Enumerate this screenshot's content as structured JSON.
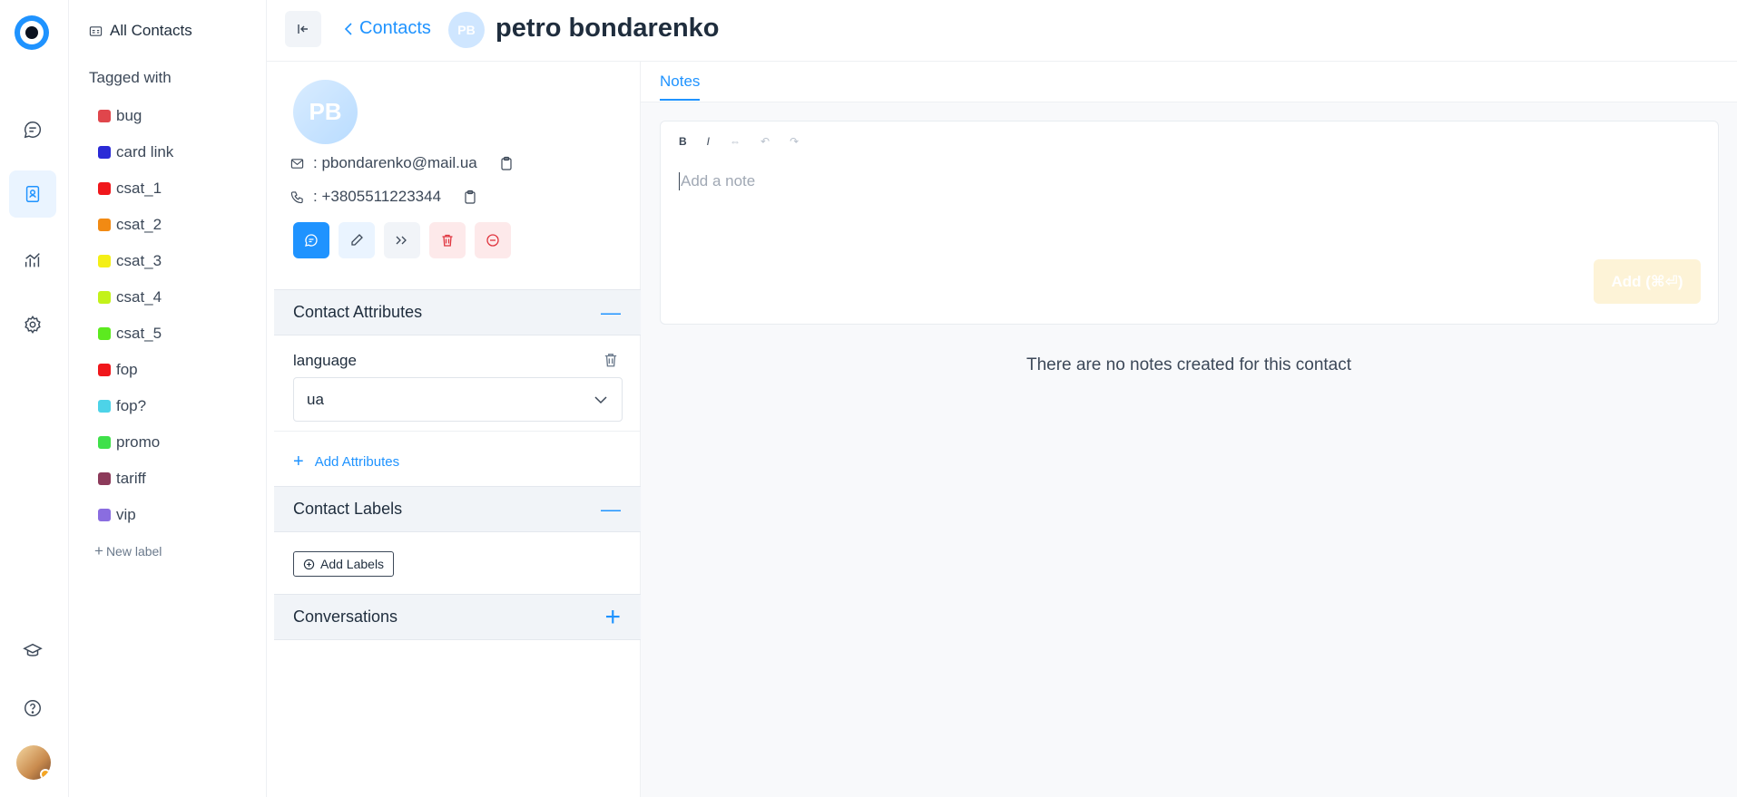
{
  "sidebar": {
    "all_contacts": "All Contacts",
    "tagged_with": "Tagged with",
    "labels": [
      {
        "name": "bug",
        "color": "#e0464c"
      },
      {
        "name": "card link",
        "color": "#2a2ad6"
      },
      {
        "name": "csat_1",
        "color": "#f0171b"
      },
      {
        "name": "csat_2",
        "color": "#f28a13"
      },
      {
        "name": "csat_3",
        "color": "#f4ef16"
      },
      {
        "name": "csat_4",
        "color": "#c3f21a"
      },
      {
        "name": "csat_5",
        "color": "#5cea1f"
      },
      {
        "name": "fop",
        "color": "#f0171b"
      },
      {
        "name": "fop?",
        "color": "#4dd3e8"
      },
      {
        "name": "promo",
        "color": "#3fe04a"
      },
      {
        "name": "tariff",
        "color": "#8c3a5a"
      },
      {
        "name": "vip",
        "color": "#8a6de0"
      }
    ],
    "new_label": "New label"
  },
  "header": {
    "breadcrumb": "Contacts",
    "avatar_initials": "PB",
    "contact_name": "petro bondarenko"
  },
  "contact": {
    "initials": "PB",
    "email": ": pbondarenko@mail.ua",
    "phone": ": +3805511223344"
  },
  "attributes": {
    "title": "Contact Attributes",
    "items": [
      {
        "name": "language",
        "value": "ua"
      }
    ],
    "add_label": "Add Attributes"
  },
  "labels_section": {
    "title": "Contact Labels",
    "add_label": "Add Labels"
  },
  "conversations": {
    "title": "Conversations"
  },
  "notes": {
    "tab": "Notes",
    "toolbar": {
      "bold": "B",
      "italic": "I"
    },
    "placeholder": "Add a note",
    "add_button": "Add (⌘⏎)",
    "empty_text": "There are no notes created for this contact"
  },
  "colors": {
    "accent": "#1f93ff",
    "danger": "#e0353f"
  }
}
